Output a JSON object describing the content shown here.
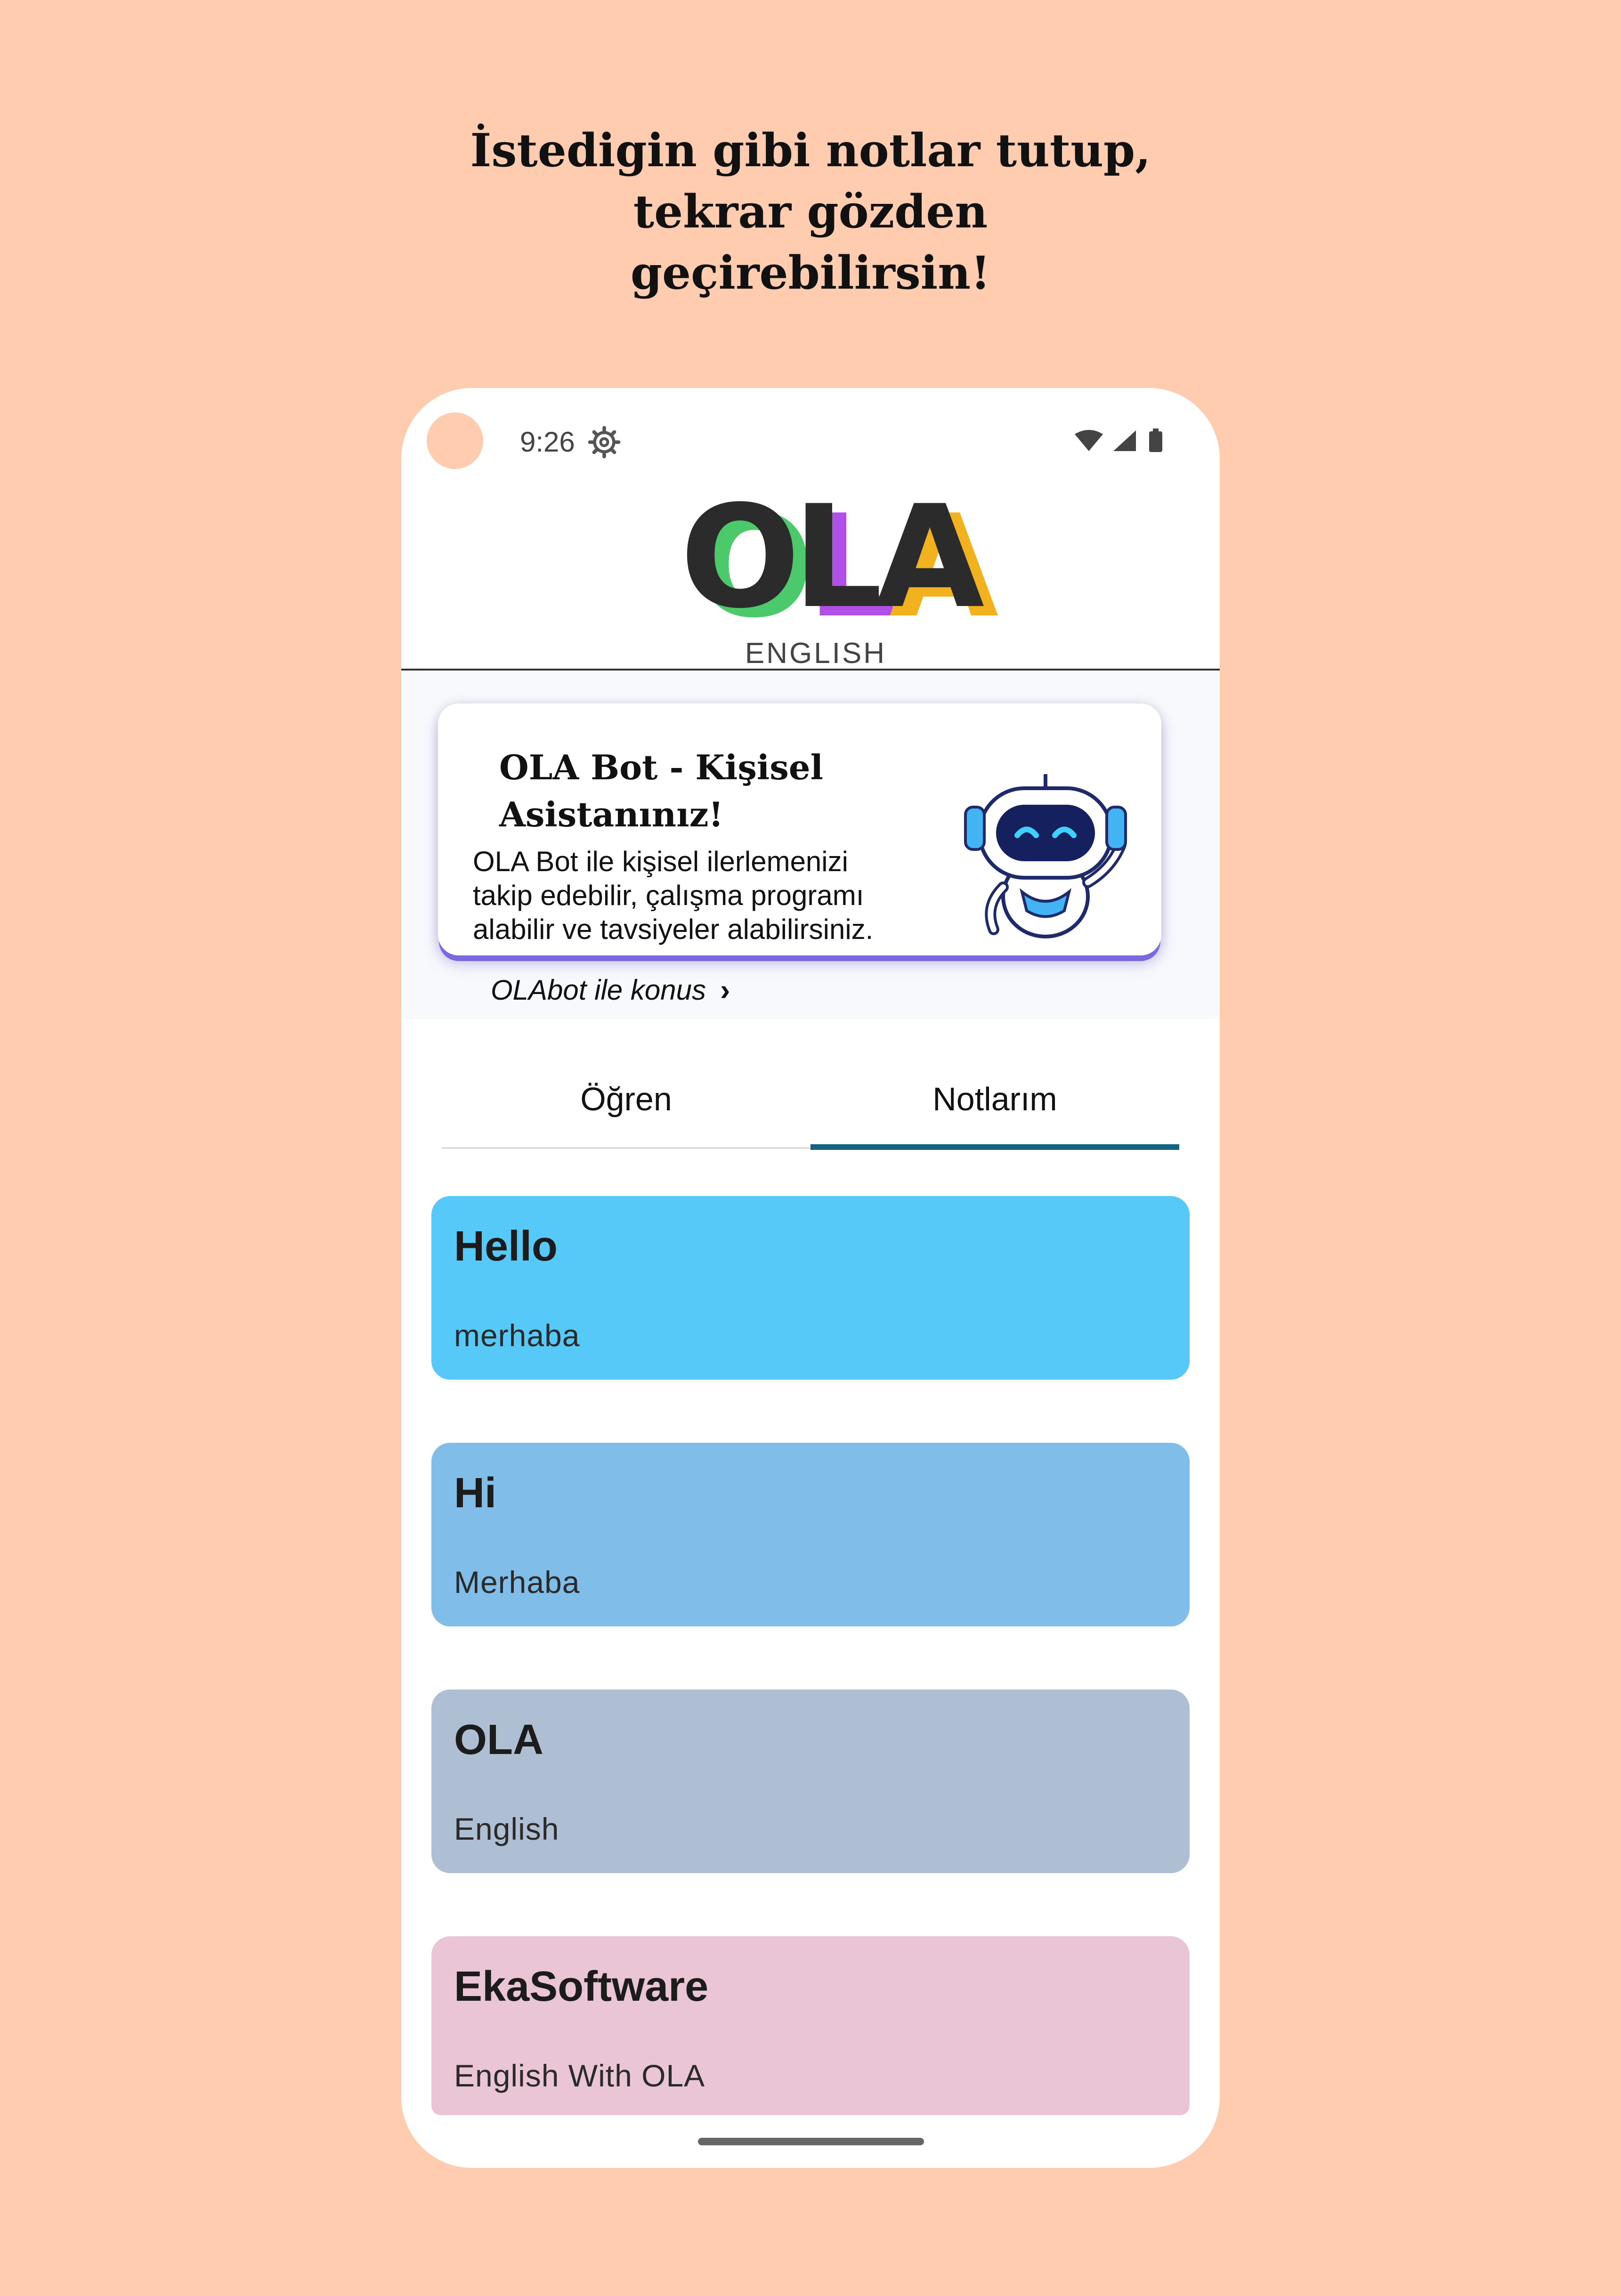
{
  "headline": {
    "line1": "İstedigin gibi notlar tutup,",
    "line2": "tekrar gözden",
    "line3": "geçirebilirsin!"
  },
  "status_bar": {
    "time": "9:26"
  },
  "logo": {
    "brand": "OLA",
    "subtitle": "ENGLISH"
  },
  "bot_card": {
    "title_line1": "OLA Bot - Kişisel",
    "title_line2": "Asistanınız!",
    "description_line1": "OLA Bot ile kişisel ilerlemenizi",
    "description_line2": "takip edebilir, çalışma programı",
    "description_line3": "alabilir ve tavsiyeler alabilirsiniz.",
    "link_label": "OLAbot ile konus"
  },
  "tabs": [
    {
      "label": "Öğren",
      "selected": false
    },
    {
      "label": "Notlarım",
      "selected": true
    }
  ],
  "notes": [
    {
      "title": "Hello",
      "subtitle": "merhaba",
      "color": "#56c9f8"
    },
    {
      "title": "Hi",
      "subtitle": "Merhaba",
      "color": "#80bde9"
    },
    {
      "title": "OLA",
      "subtitle": "English",
      "color": "#aebed3"
    },
    {
      "title": "EkaSoftware",
      "subtitle": "English With OLA",
      "color": "#eac5d6"
    }
  ],
  "colors": {
    "background": "#ffccb0",
    "tab_indicator": "#14637e",
    "bot_card_accent": "#7a69e0"
  }
}
